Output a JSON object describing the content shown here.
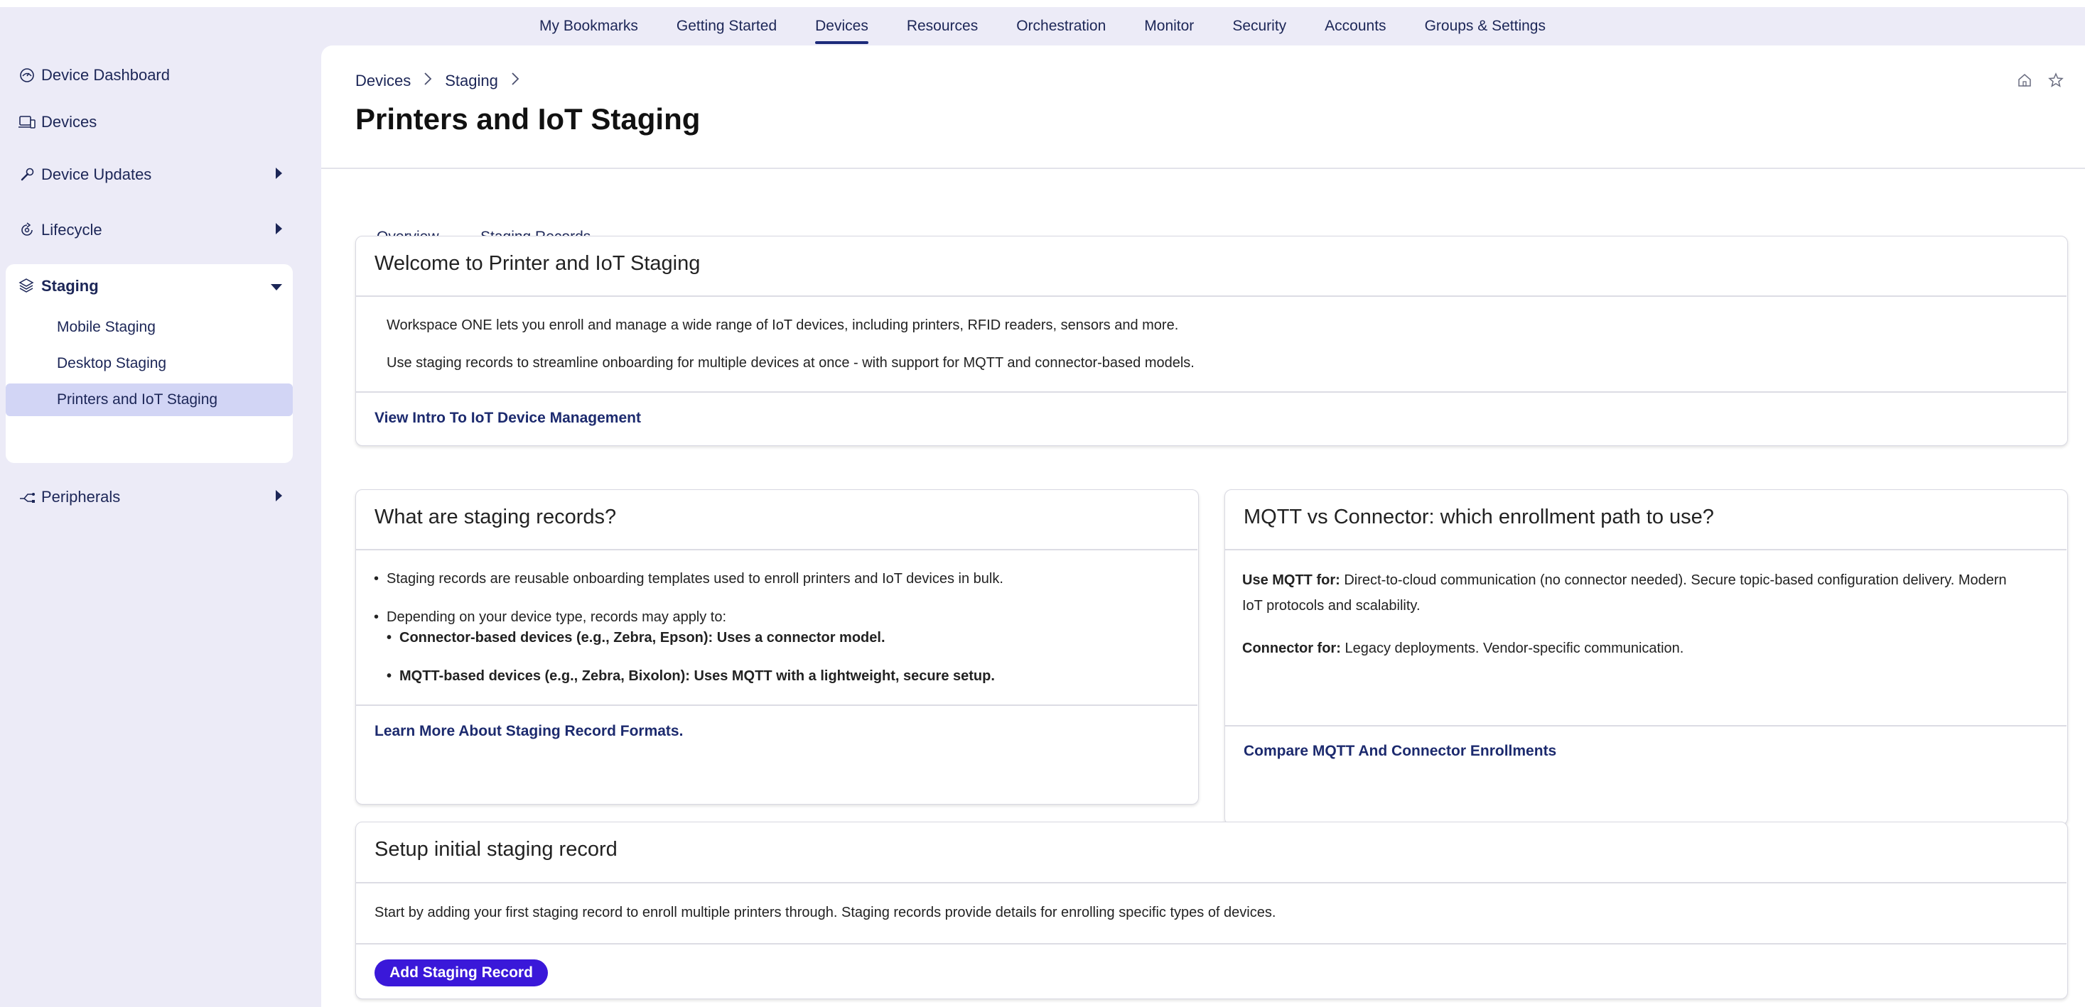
{
  "topnav": [
    {
      "label": "My Bookmarks",
      "active": false
    },
    {
      "label": "Getting Started",
      "active": false
    },
    {
      "label": "Devices",
      "active": true
    },
    {
      "label": "Resources",
      "active": false
    },
    {
      "label": "Orchestration",
      "active": false
    },
    {
      "label": "Monitor",
      "active": false
    },
    {
      "label": "Security",
      "active": false
    },
    {
      "label": "Accounts",
      "active": false
    },
    {
      "label": "Groups & Settings",
      "active": false
    }
  ],
  "sidebar": {
    "items": [
      {
        "label": "Device Dashboard",
        "icon": "dashboard-icon"
      },
      {
        "label": "Devices",
        "icon": "devices-icon"
      },
      {
        "label": "Device Updates",
        "icon": "wrench-icon"
      },
      {
        "label": "Lifecycle",
        "icon": "lifecycle-icon"
      },
      {
        "label": "Staging",
        "icon": "layers-icon"
      },
      {
        "label": "Peripherals",
        "icon": "peripherals-icon"
      }
    ],
    "staging_sub": [
      {
        "label": "Mobile Staging",
        "active": false
      },
      {
        "label": "Desktop Staging",
        "active": false
      },
      {
        "label": "Printers and IoT Staging",
        "active": true
      }
    ]
  },
  "breadcrumb": {
    "items": [
      "Devices",
      "Staging"
    ]
  },
  "page": {
    "title": "Printers and IoT Staging"
  },
  "tabs": [
    {
      "label": "Overview",
      "active": true
    },
    {
      "label": "Staging Records",
      "active": false
    }
  ],
  "welcome": {
    "title": "Welcome to Printer and IoT Staging",
    "p1": "Workspace ONE lets you enroll and manage a wide range of IoT devices, including printers, RFID readers, sensors and more.",
    "p2": "Use staging records to streamline onboarding for multiple devices at once - with support for MQTT and connector-based models.",
    "link": "View Intro To IoT Device Management"
  },
  "records": {
    "title": "What are staging records?",
    "b1": "Staging records are reusable onboarding templates used to enroll printers and IoT devices in bulk.",
    "b2": "Depending on your device type, records may apply to:",
    "b3": "Connector-based devices (e.g., Zebra, Epson): Uses a connector model.",
    "b4": "MQTT-based devices (e.g., Zebra, Bixolon): Uses MQTT with a lightweight, secure setup.",
    "link": "Learn More About Staging Record Formats."
  },
  "mqtt": {
    "title": "MQTT vs Connector: which enrollment path to use?",
    "mqtt_label": "Use MQTT for:",
    "mqtt_text_1": " Direct-to-cloud communication (no connector needed). Secure topic-based configuration delivery. Modern",
    "mqtt_text_2": "IoT protocols and scalability.",
    "conn_label": "Connector for:",
    "conn_text": " Legacy deployments. Vendor-specific communication.",
    "link": "Compare MQTT And Connector Enrollments"
  },
  "setup": {
    "title": "Setup initial staging record",
    "text": "Start by adding your first staging record to enroll multiple printers through. Staging records provide details for enrolling specific types of devices.",
    "button": "Add Staging Record"
  },
  "colors": {
    "accent": "#3a18d9",
    "nav_active": "#1c2a7a",
    "sidebar_bg": "#ecebf7",
    "active_sub_bg": "#d2d5f5"
  }
}
